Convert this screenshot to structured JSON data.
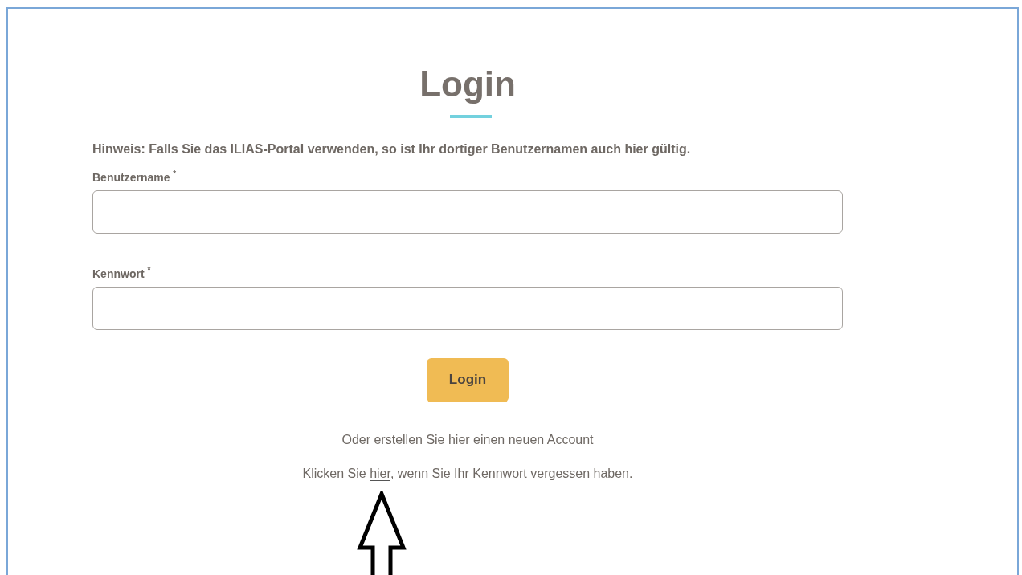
{
  "title": "Login",
  "notice": "Hinweis: Falls Sie das ILIAS-Portal verwenden, so ist Ihr dortiger Benutzernamen auch hier gültig.",
  "fields": [
    {
      "label": "Benutzername",
      "required_mark": "*"
    },
    {
      "label": "Kennwort",
      "required_mark": "*"
    }
  ],
  "submit": "Login",
  "links": [
    {
      "before": "Oder erstellen Sie ",
      "link": "hier",
      "after": " einen neuen Account"
    },
    {
      "before": "Klicken Sie ",
      "link": "hier",
      "after": ", wenn Sie Ihr Kennwort vergessen haben."
    }
  ]
}
